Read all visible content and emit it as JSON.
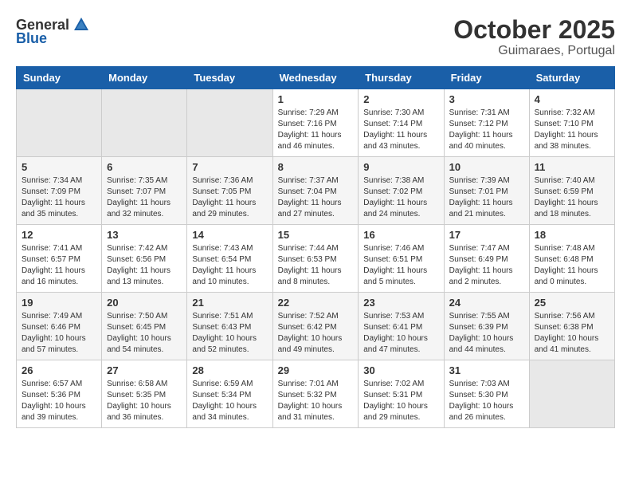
{
  "logo": {
    "general": "General",
    "blue": "Blue"
  },
  "title": "October 2025",
  "subtitle": "Guimaraes, Portugal",
  "days_of_week": [
    "Sunday",
    "Monday",
    "Tuesday",
    "Wednesday",
    "Thursday",
    "Friday",
    "Saturday"
  ],
  "weeks": [
    [
      {
        "day": "",
        "info": ""
      },
      {
        "day": "",
        "info": ""
      },
      {
        "day": "",
        "info": ""
      },
      {
        "day": "1",
        "info": "Sunrise: 7:29 AM\nSunset: 7:16 PM\nDaylight: 11 hours\nand 46 minutes."
      },
      {
        "day": "2",
        "info": "Sunrise: 7:30 AM\nSunset: 7:14 PM\nDaylight: 11 hours\nand 43 minutes."
      },
      {
        "day": "3",
        "info": "Sunrise: 7:31 AM\nSunset: 7:12 PM\nDaylight: 11 hours\nand 40 minutes."
      },
      {
        "day": "4",
        "info": "Sunrise: 7:32 AM\nSunset: 7:10 PM\nDaylight: 11 hours\nand 38 minutes."
      }
    ],
    [
      {
        "day": "5",
        "info": "Sunrise: 7:34 AM\nSunset: 7:09 PM\nDaylight: 11 hours\nand 35 minutes."
      },
      {
        "day": "6",
        "info": "Sunrise: 7:35 AM\nSunset: 7:07 PM\nDaylight: 11 hours\nand 32 minutes."
      },
      {
        "day": "7",
        "info": "Sunrise: 7:36 AM\nSunset: 7:05 PM\nDaylight: 11 hours\nand 29 minutes."
      },
      {
        "day": "8",
        "info": "Sunrise: 7:37 AM\nSunset: 7:04 PM\nDaylight: 11 hours\nand 27 minutes."
      },
      {
        "day": "9",
        "info": "Sunrise: 7:38 AM\nSunset: 7:02 PM\nDaylight: 11 hours\nand 24 minutes."
      },
      {
        "day": "10",
        "info": "Sunrise: 7:39 AM\nSunset: 7:01 PM\nDaylight: 11 hours\nand 21 minutes."
      },
      {
        "day": "11",
        "info": "Sunrise: 7:40 AM\nSunset: 6:59 PM\nDaylight: 11 hours\nand 18 minutes."
      }
    ],
    [
      {
        "day": "12",
        "info": "Sunrise: 7:41 AM\nSunset: 6:57 PM\nDaylight: 11 hours\nand 16 minutes."
      },
      {
        "day": "13",
        "info": "Sunrise: 7:42 AM\nSunset: 6:56 PM\nDaylight: 11 hours\nand 13 minutes."
      },
      {
        "day": "14",
        "info": "Sunrise: 7:43 AM\nSunset: 6:54 PM\nDaylight: 11 hours\nand 10 minutes."
      },
      {
        "day": "15",
        "info": "Sunrise: 7:44 AM\nSunset: 6:53 PM\nDaylight: 11 hours\nand 8 minutes."
      },
      {
        "day": "16",
        "info": "Sunrise: 7:46 AM\nSunset: 6:51 PM\nDaylight: 11 hours\nand 5 minutes."
      },
      {
        "day": "17",
        "info": "Sunrise: 7:47 AM\nSunset: 6:49 PM\nDaylight: 11 hours\nand 2 minutes."
      },
      {
        "day": "18",
        "info": "Sunrise: 7:48 AM\nSunset: 6:48 PM\nDaylight: 11 hours\nand 0 minutes."
      }
    ],
    [
      {
        "day": "19",
        "info": "Sunrise: 7:49 AM\nSunset: 6:46 PM\nDaylight: 10 hours\nand 57 minutes."
      },
      {
        "day": "20",
        "info": "Sunrise: 7:50 AM\nSunset: 6:45 PM\nDaylight: 10 hours\nand 54 minutes."
      },
      {
        "day": "21",
        "info": "Sunrise: 7:51 AM\nSunset: 6:43 PM\nDaylight: 10 hours\nand 52 minutes."
      },
      {
        "day": "22",
        "info": "Sunrise: 7:52 AM\nSunset: 6:42 PM\nDaylight: 10 hours\nand 49 minutes."
      },
      {
        "day": "23",
        "info": "Sunrise: 7:53 AM\nSunset: 6:41 PM\nDaylight: 10 hours\nand 47 minutes."
      },
      {
        "day": "24",
        "info": "Sunrise: 7:55 AM\nSunset: 6:39 PM\nDaylight: 10 hours\nand 44 minutes."
      },
      {
        "day": "25",
        "info": "Sunrise: 7:56 AM\nSunset: 6:38 PM\nDaylight: 10 hours\nand 41 minutes."
      }
    ],
    [
      {
        "day": "26",
        "info": "Sunrise: 6:57 AM\nSunset: 5:36 PM\nDaylight: 10 hours\nand 39 minutes."
      },
      {
        "day": "27",
        "info": "Sunrise: 6:58 AM\nSunset: 5:35 PM\nDaylight: 10 hours\nand 36 minutes."
      },
      {
        "day": "28",
        "info": "Sunrise: 6:59 AM\nSunset: 5:34 PM\nDaylight: 10 hours\nand 34 minutes."
      },
      {
        "day": "29",
        "info": "Sunrise: 7:01 AM\nSunset: 5:32 PM\nDaylight: 10 hours\nand 31 minutes."
      },
      {
        "day": "30",
        "info": "Sunrise: 7:02 AM\nSunset: 5:31 PM\nDaylight: 10 hours\nand 29 minutes."
      },
      {
        "day": "31",
        "info": "Sunrise: 7:03 AM\nSunset: 5:30 PM\nDaylight: 10 hours\nand 26 minutes."
      },
      {
        "day": "",
        "info": ""
      }
    ]
  ]
}
